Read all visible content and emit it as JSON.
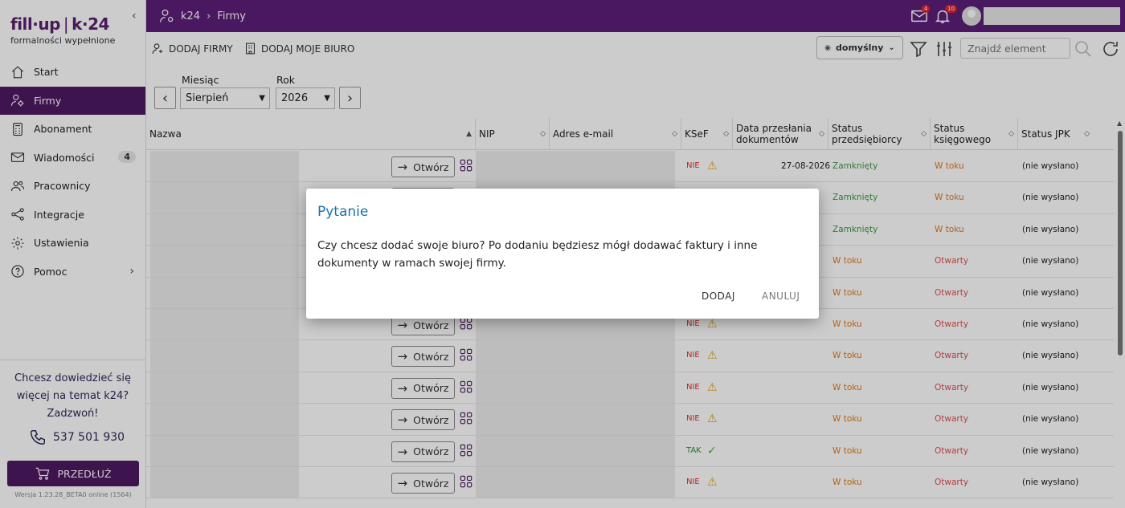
{
  "brand": {
    "logo_left": "fill·up",
    "logo_right": "k·24",
    "tagline": "formalności wypełnione"
  },
  "sidebar": {
    "items": [
      {
        "label": "Start",
        "icon": "home-icon"
      },
      {
        "label": "Firmy",
        "icon": "companies-icon",
        "active": true
      },
      {
        "label": "Abonament",
        "icon": "calculator-icon"
      },
      {
        "label": "Wiadomości",
        "icon": "mail-icon",
        "badge": "4"
      },
      {
        "label": "Pracownicy",
        "icon": "people-icon"
      },
      {
        "label": "Integracje",
        "icon": "share-icon"
      },
      {
        "label": "Ustawienia",
        "icon": "gear-icon"
      },
      {
        "label": "Pomoc",
        "icon": "help-icon"
      }
    ],
    "promo_line1": "Chcesz dowiedzieć się",
    "promo_line2": "więcej na temat k24?",
    "promo_line3": "Zadzwoń!",
    "phone": "537 501 930",
    "extend_label": "PRZEDŁUŻ",
    "version": "Wersja 1.23.28_BETA0 online (1564)"
  },
  "topbar": {
    "breadcrumb_root": "k24",
    "breadcrumb_page": "Firmy",
    "mail_count": "4",
    "bell_count": "10"
  },
  "toolbar": {
    "add_companies": "DODAJ FIRMY",
    "add_office": "DODAJ MOJE BIURO",
    "preset": "domyślny",
    "search_placeholder": "Znajdź element"
  },
  "filters": {
    "month_label": "Miesiąc",
    "month_value": "Sierpień",
    "year_label": "Rok",
    "year_value": "2026"
  },
  "table": {
    "headers": [
      "Nazwa",
      "NIP",
      "Adres e-mail",
      "KSeF",
      "Data przesłania dokumentów",
      "Status przedsiębiorcy",
      "Status księgowego",
      "Status JPK"
    ],
    "open_label": "Otwórz",
    "rows": [
      {
        "ksef": "NIE",
        "date": "27-08-2026",
        "owner": "Zamknięty",
        "owner_color": "green",
        "acc": "W toku",
        "acc_color": "orange",
        "jpk": "(nie wysłano)"
      },
      {
        "ksef": "",
        "date": "26",
        "owner": "Zamknięty",
        "owner_color": "green",
        "acc": "W toku",
        "acc_color": "orange",
        "jpk": "(nie wysłano)"
      },
      {
        "ksef": "",
        "date": "26",
        "owner": "Zamknięty",
        "owner_color": "green",
        "acc": "W toku",
        "acc_color": "orange",
        "jpk": "(nie wysłano)"
      },
      {
        "ksef": "",
        "date": "",
        "owner": "W toku",
        "owner_color": "orange",
        "acc": "Otwarty",
        "acc_color": "red",
        "jpk": "(nie wysłano)"
      },
      {
        "ksef": "",
        "date": "",
        "owner": "W toku",
        "owner_color": "orange",
        "acc": "Otwarty",
        "acc_color": "red",
        "jpk": "(nie wysłano)"
      },
      {
        "ksef": "NIE",
        "date": "",
        "owner": "W toku",
        "owner_color": "orange",
        "acc": "Otwarty",
        "acc_color": "red",
        "jpk": "(nie wysłano)"
      },
      {
        "ksef": "NIE",
        "date": "",
        "owner": "W toku",
        "owner_color": "orange",
        "acc": "Otwarty",
        "acc_color": "red",
        "jpk": "(nie wysłano)"
      },
      {
        "ksef": "NIE",
        "date": "",
        "owner": "W toku",
        "owner_color": "orange",
        "acc": "Otwarty",
        "acc_color": "red",
        "jpk": "(nie wysłano)"
      },
      {
        "ksef": "NIE",
        "date": "",
        "owner": "W toku",
        "owner_color": "orange",
        "acc": "Otwarty",
        "acc_color": "red",
        "jpk": "(nie wysłano)"
      },
      {
        "ksef": "TAK",
        "date": "",
        "owner": "W toku",
        "owner_color": "orange",
        "acc": "Otwarty",
        "acc_color": "red",
        "jpk": "(nie wysłano)"
      },
      {
        "ksef": "NIE",
        "date": "",
        "owner": "W toku",
        "owner_color": "orange",
        "acc": "Otwarty",
        "acc_color": "red",
        "jpk": "(nie wysłano)"
      }
    ]
  },
  "dialog": {
    "title": "Pytanie",
    "text": "Czy chcesz dodać swoje biuro? Po dodaniu będziesz mógł dodawać faktury i inne dokumenty w ramach swojej firmy.",
    "confirm": "DODAJ",
    "cancel": "ANULUJ"
  },
  "colors": {
    "brand_purple": "#5c1f7a",
    "active_nav": "#4e1a62",
    "dialog_title": "#1a73a8"
  }
}
